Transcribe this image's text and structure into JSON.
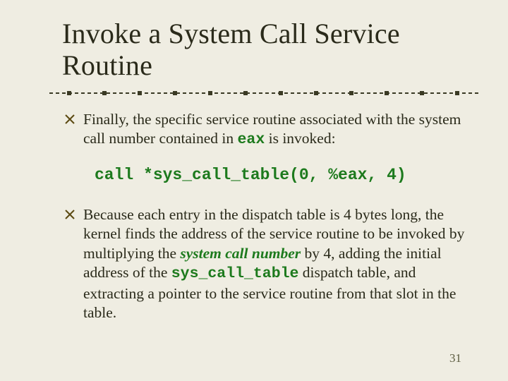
{
  "title_line_1": "Invoke a System Call Service",
  "title_line_2": "Routine",
  "bullet_1": {
    "pre": "Finally, the specific service routine associated with the system call number contained in ",
    "code": "eax",
    "post": " is invoked:"
  },
  "code_block": "call *sys_call_table(0, %eax, 4)",
  "bullet_2": {
    "p1": "Because each entry in the dispatch table is 4 bytes long, the kernel finds the address of the service routine to be invoked by multiplying the ",
    "em": "system call number",
    "p2": " by 4, adding the initial address of the ",
    "code": "sys_call_table",
    "p3": " dispatch table, and extracting a pointer to the service routine from that slot in the table."
  },
  "page_number": "31"
}
